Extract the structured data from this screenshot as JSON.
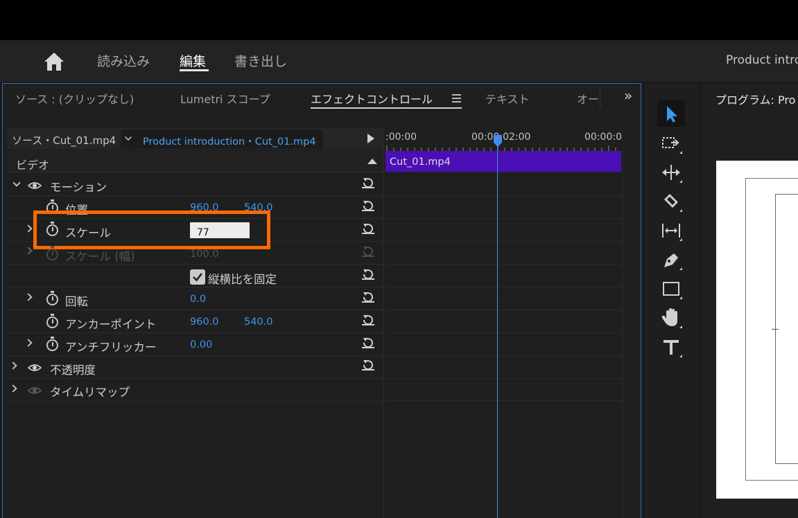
{
  "menu": {
    "home_icon": "home-icon",
    "tabs": [
      {
        "label": "読み込み"
      },
      {
        "label": "編集",
        "active": true
      },
      {
        "label": "書き出し"
      }
    ],
    "project_title": "Product intro"
  },
  "effects_panel": {
    "tabs": [
      {
        "label": "ソース : (クリップなし)"
      },
      {
        "label": "Lumetri スコープ"
      },
      {
        "label": "エフェクトコントロール",
        "active": true
      },
      {
        "label": "テキスト"
      },
      {
        "label": "オー"
      }
    ],
    "more_tabs": "»",
    "source_label": "ソース・Cut_01.mp4",
    "sequence_label": "Product introduction・Cut_01.mp4",
    "video_section": "ビデオ",
    "motion": "モーション",
    "properties": {
      "position": {
        "label": "位置",
        "x": "960.0",
        "y": "540.0"
      },
      "scale": {
        "label": "スケール",
        "value": "77"
      },
      "scale_width": {
        "label": "スケール (幅)",
        "value": "100.0"
      },
      "uniform_scale": {
        "label": "縦横比を固定",
        "checked": true
      },
      "rotation": {
        "label": "回転",
        "value": "0.0"
      },
      "anchor_point": {
        "label": "アンカーポイント",
        "x": "960.0",
        "y": "540.0"
      },
      "anti_flicker": {
        "label": "アンチフリッカー",
        "value": "0.00"
      }
    },
    "opacity": "不透明度",
    "time_remap": "タイムリマップ"
  },
  "timeline": {
    "time_start": ":00:00",
    "time_mid": "00:00:02:00",
    "time_end": "00:00:0",
    "clip_name": "Cut_01.mp4"
  },
  "program": {
    "label": "プログラム: Pro"
  },
  "colors": {
    "accent_blue": "#3d97f0",
    "highlight_orange": "#ff6a00",
    "clip_purple": "#4b0fb5"
  }
}
